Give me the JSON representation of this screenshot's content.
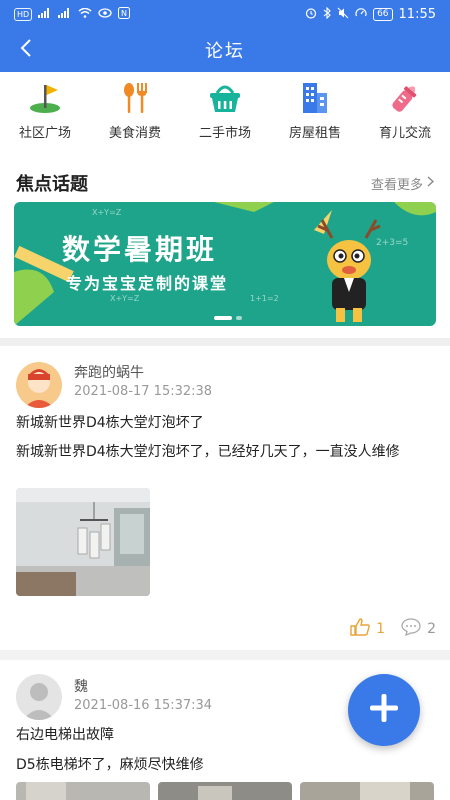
{
  "status_bar": {
    "carrier_chips": [
      "HD",
      "HD"
    ],
    "signal": "4G",
    "battery": "66",
    "time": "11:55"
  },
  "header": {
    "title": "论坛"
  },
  "categories": [
    {
      "label": "社区广场",
      "icon": "golf-flag-icon"
    },
    {
      "label": "美食消费",
      "icon": "fork-spoon-icon"
    },
    {
      "label": "二手市场",
      "icon": "basket-icon"
    },
    {
      "label": "房屋租售",
      "icon": "building-icon"
    },
    {
      "label": "育儿交流",
      "icon": "baby-bottle-icon"
    }
  ],
  "focus": {
    "title": "焦点话题",
    "see_more": "查看更多",
    "banner": {
      "title": "数学暑期班",
      "subtitle": "专为宝宝定制的课堂",
      "decorations": [
        "X+Y=Z",
        "2+3=5",
        "X+Y=Z",
        "1+1=2"
      ]
    }
  },
  "posts": [
    {
      "author": "奔跑的蜗牛",
      "time": "2021-08-17 15:32:38",
      "title": "新城新世界D4栋大堂灯泡坏了",
      "body": "新城新世界D4栋大堂灯泡坏了，已经好几天了，一直没人维修",
      "likes": "1",
      "comments": "2"
    },
    {
      "author": "魏",
      "time": "2021-08-16 15:37:34",
      "title": "右边电梯出故障",
      "body": "D5栋电梯坏了，麻烦尽快维修"
    }
  ],
  "colors": {
    "primary": "#3a7ae8",
    "banner_green": "#1ea48a",
    "like_orange": "#e8a43a"
  }
}
